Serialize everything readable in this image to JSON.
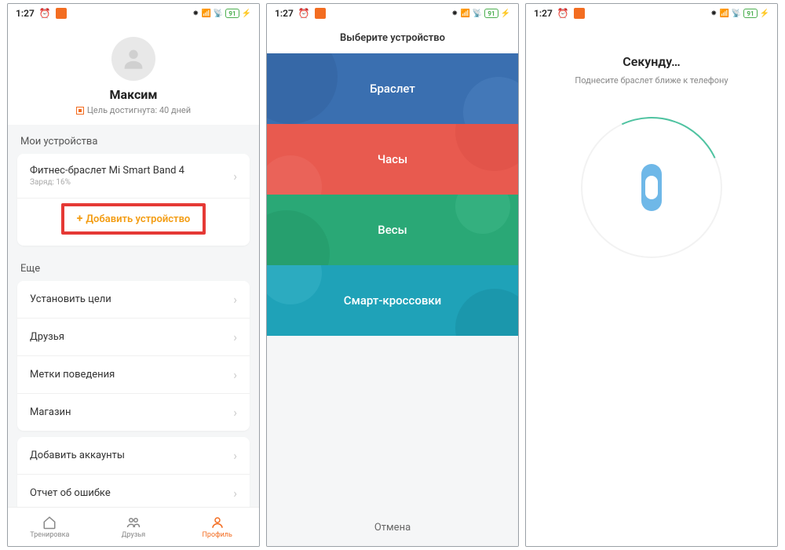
{
  "status": {
    "time": "1:27",
    "battery": "91"
  },
  "screen1": {
    "username": "Максим",
    "goal_text": "Цель достигнута: 40 дней",
    "section_devices": "Мои устройства",
    "device_name": "Фитнес-браслет Mi Smart Band 4",
    "device_charge": "Заряд: 16%",
    "add_device": "Добавить устройство",
    "section_more": "Еще",
    "rows": {
      "goals": "Установить цели",
      "friends": "Друзья",
      "behavior": "Метки поведения",
      "store": "Магазин",
      "accounts": "Добавить аккаунты",
      "report": "Отчет об ошибке"
    },
    "nav": {
      "train": "Тренировка",
      "friends": "Друзья",
      "profile": "Профиль"
    }
  },
  "screen2": {
    "title": "Выберите устройство",
    "bracelet": "Браслет",
    "watch": "Часы",
    "scale": "Весы",
    "shoe": "Смарт-кроссовки",
    "cancel": "Отмена"
  },
  "screen3": {
    "title": "Секунду…",
    "sub": "Поднесите браслет ближе к телефону"
  }
}
